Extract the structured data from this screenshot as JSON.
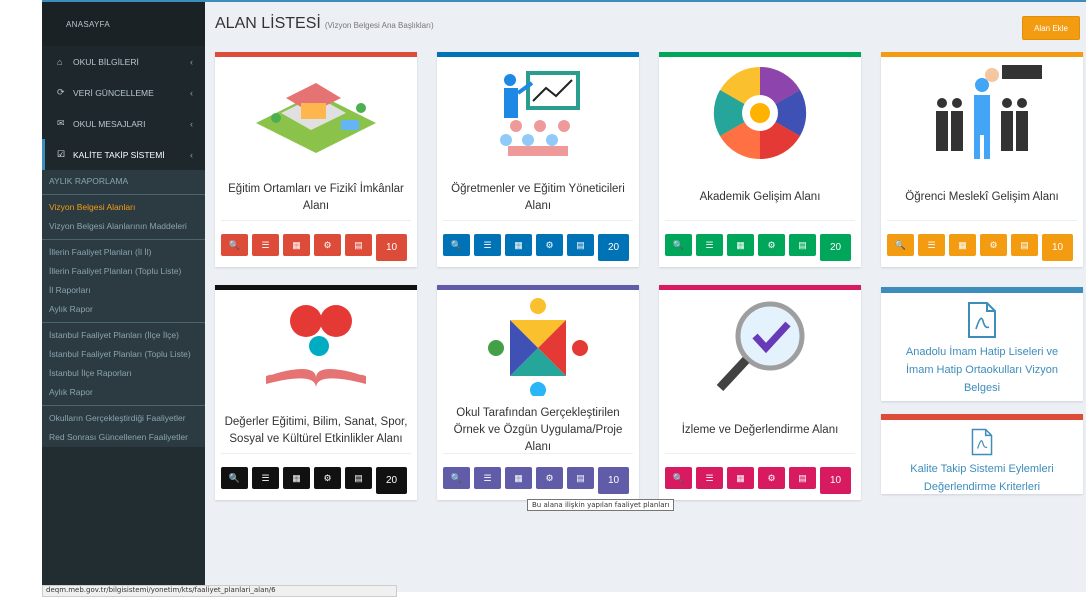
{
  "sidebar": {
    "brand": "ANASAYFA",
    "menu": [
      {
        "label": "OKUL BİLGİLERİ",
        "icon": "home-icon",
        "glyph": "⌂"
      },
      {
        "label": "VERİ GÜNCELLEME",
        "icon": "refresh-icon",
        "glyph": "⟳"
      },
      {
        "label": "OKUL MESAJLARI",
        "icon": "envelope-icon",
        "glyph": "✉"
      },
      {
        "label": "KALİTE TAKİP SİSTEMİ",
        "icon": "checkbox-icon",
        "glyph": "☑"
      }
    ],
    "items": [
      "AYLIK RAPORLAMA",
      "Vizyon Belgesi Alanları",
      "Vizyon Belgesi Alanlarının Maddeleri",
      "İllerin Faaliyet Planları (İl İl)",
      "İllerin Faaliyet Planları (Toplu Liste)",
      "İl Raporları",
      "Aylık Rapor",
      "İstanbul Faaliyet Planları (İlçe İlçe)",
      "İstanbul Faaliyet Planları (Toplu Liste)",
      "İstanbul İlçe Raporları",
      "Aylık Rapor",
      "Okulların Gerçekleştirdiği Faaliyetler",
      "Red Sonrası Güncellenen Faaliyetler"
    ],
    "status_url": "deqm.meb.gov.tr/bilgisistemi/yonetim/kts/faaliyet_planlari_alan/6"
  },
  "header": {
    "title": "ALAN LİSTESİ",
    "subtitle": "(Vizyon Belgesi Ana Başlıkları)",
    "add_button": "Alan Ekle"
  },
  "cards": [
    {
      "title": "Eğitim Ortamları ve Fizikî İmkânlar Alanı",
      "count": "10",
      "color": "#dd4b39",
      "image": "campus-illustration"
    },
    {
      "title": "Öğretmenler ve Eğitim Yöneticileri Alanı",
      "count": "20",
      "color": "#0073b7",
      "image": "teacher-board-illustration"
    },
    {
      "title": "Akademik Gelişim Alanı",
      "count": "20",
      "color": "#00a65a",
      "image": "academic-wheel-illustration"
    },
    {
      "title": "Öğrenci Meslekî Gelişim Alanı",
      "count": "10",
      "color": "#f39c12",
      "image": "career-people-illustration"
    },
    {
      "title": "Değerler Eğitimi, Bilim, Sanat, Spor, Sosyal ve Kültürel Etkinlikler Alanı",
      "count": "20",
      "color": "#111111",
      "image": "open-book-illustration"
    },
    {
      "title": "Okul Tarafından Gerçekleştirilen Örnek ve Özgün Uygulama/Proje Alanı",
      "count": "10",
      "color": "#605ca8",
      "image": "team-circle-illustration"
    },
    {
      "title": "İzleme ve Değerlendirme Alanı",
      "count": "10",
      "color": "#d81b60",
      "image": "magnifier-check-illustration"
    }
  ],
  "buttons": [
    {
      "name": "search-button",
      "icon": "search-icon",
      "glyph": "🔍"
    },
    {
      "name": "list-button",
      "icon": "list-icon",
      "glyph": "☰"
    },
    {
      "name": "calendar-button",
      "icon": "calendar-icon",
      "glyph": "▦"
    },
    {
      "name": "settings-button",
      "icon": "cogs-icon",
      "glyph": "⚙"
    },
    {
      "name": "report-button",
      "icon": "table-icon",
      "glyph": "▤"
    }
  ],
  "docs": [
    {
      "title": "Anadolu İmam Hatip Liseleri ve İmam Hatip Ortaokulları Vizyon Belgesi",
      "color": "#3c8dbc"
    },
    {
      "title": "Kalite Takip Sistemi Eylemleri Değerlendirme Kriterleri",
      "color": "#dd4b39"
    }
  ],
  "tooltip": "Bu alana ilişkin yapılan faaliyet planları"
}
